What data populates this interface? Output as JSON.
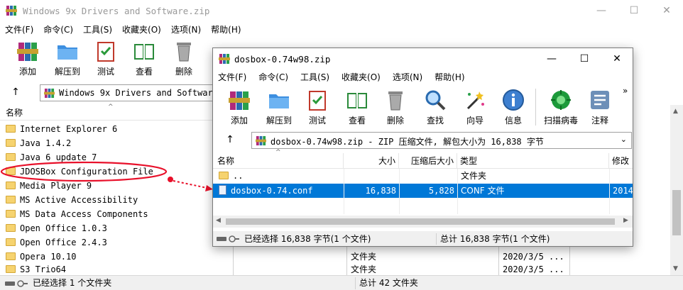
{
  "back_window": {
    "title": "Windows 9x Drivers and Software.zip",
    "menu": [
      "文件(F)",
      "命令(C)",
      "工具(S)",
      "收藏夹(O)",
      "选项(N)",
      "帮助(H)"
    ],
    "toolbar": [
      "添加",
      "解压到",
      "测试",
      "查看",
      "删除"
    ],
    "address": "Windows 9x Drivers and Software",
    "column_name": "名称",
    "files": [
      "Internet Explorer 6",
      "Java 1.4.2",
      "Java 6 update 7",
      "JDOSBox Configuration File",
      "Media Player 9",
      "MS Active Accessibility",
      "MS Data Access Components",
      "Open Office 1.0.3",
      "Open Office 2.4.3",
      "Opera 10.10",
      "S3 Trio64"
    ],
    "extra_rows": [
      {
        "type": "文件夹",
        "date": "2020/3/5 ..."
      },
      {
        "type": "文件夹",
        "date": "2020/3/5 ..."
      }
    ],
    "status_left": "已经选择 1 个文件夹",
    "status_right": "总计 42 文件夹"
  },
  "front_window": {
    "title": "dosbox-0.74w98.zip",
    "menu": [
      "文件(F)",
      "命令(C)",
      "工具(S)",
      "收藏夹(O)",
      "选项(N)",
      "帮助(H)"
    ],
    "toolbar": [
      "添加",
      "解压到",
      "测试",
      "查看",
      "删除",
      "查找",
      "向导",
      "信息",
      "扫描病毒",
      "注释"
    ],
    "more": "»",
    "address": "dosbox-0.74w98.zip - ZIP 压缩文件, 解包大小为 16,838 字节",
    "columns": [
      "名称",
      "大小",
      "压缩后大小",
      "类型",
      "修改"
    ],
    "rows": [
      {
        "name": "..",
        "size": "",
        "packed": "",
        "type": "文件夹",
        "modified": ""
      },
      {
        "name": "dosbox-0.74.conf",
        "size": "16,838",
        "packed": "5,828",
        "type": "CONF 文件",
        "modified": "2014"
      }
    ],
    "status_left": "已经选择 16,838 字节(1 个文件)",
    "status_right": "总计 16,838 字节(1 个文件)"
  },
  "colors": {
    "selection": "#0078d7",
    "annotation": "#e8102a"
  }
}
